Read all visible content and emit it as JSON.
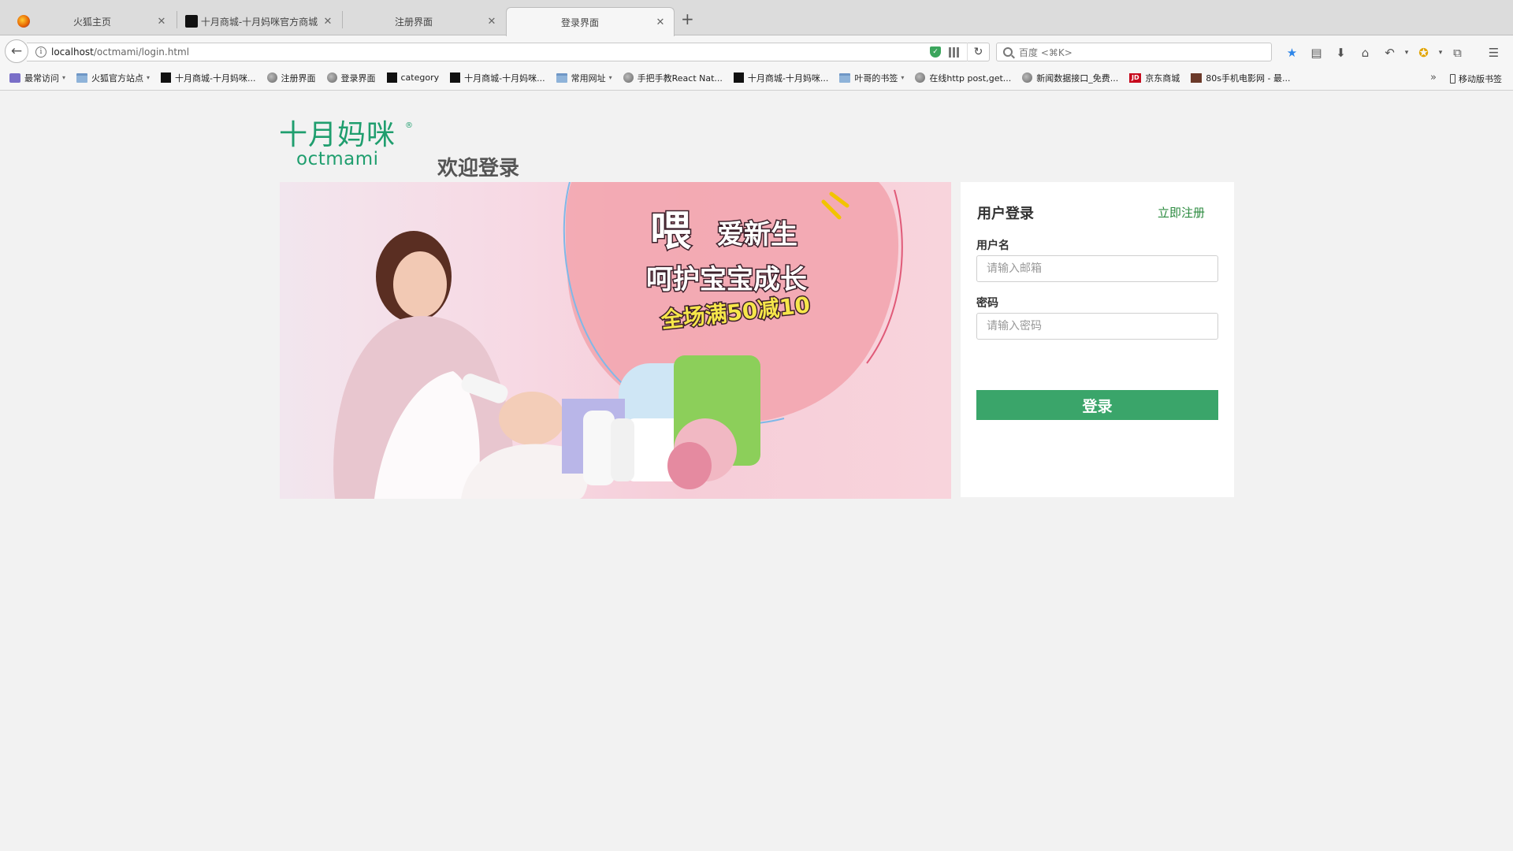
{
  "browser": {
    "tabs": [
      {
        "title": "火狐主页",
        "active": false
      },
      {
        "title": "十月商城-十月妈咪官方商城",
        "active": false
      },
      {
        "title": "注册界面",
        "active": false
      },
      {
        "title": "登录界面",
        "active": true
      }
    ],
    "url": {
      "host": "localhost",
      "path": "/octmami/login.html"
    },
    "search_placeholder": "百度 <⌘K>",
    "bookmarks": [
      {
        "label": "最常访问",
        "icon": "most-visited-icon",
        "dropdown": true
      },
      {
        "label": "火狐官方站点",
        "icon": "folder-icon",
        "dropdown": true
      },
      {
        "label": "十月商城-十月妈咪...",
        "icon": "site-favicon-black"
      },
      {
        "label": "注册界面",
        "icon": "globe-icon"
      },
      {
        "label": "登录界面",
        "icon": "globe-icon"
      },
      {
        "label": "category",
        "icon": "site-favicon-black"
      },
      {
        "label": "十月商城-十月妈咪...",
        "icon": "site-favicon-black"
      },
      {
        "label": "常用网址",
        "icon": "folder-icon",
        "dropdown": true
      },
      {
        "label": "手把手教React Nat...",
        "icon": "globe-icon"
      },
      {
        "label": "十月商城-十月妈咪...",
        "icon": "site-favicon-black"
      },
      {
        "label": "叶哥的书签",
        "icon": "folder-icon",
        "dropdown": true
      },
      {
        "label": "在线http post,get...",
        "icon": "globe-icon"
      },
      {
        "label": "新闻数据接口_免费...",
        "icon": "globe-icon"
      },
      {
        "label": "京东商城",
        "icon": "jd-icon"
      },
      {
        "label": "80s手机电影网 - 最...",
        "icon": "film-icon"
      }
    ],
    "mobile_bookmarks": "移动版书签",
    "more_bookmarks": "»"
  },
  "page": {
    "logo": {
      "cn": "十月妈咪",
      "en": "octmami",
      "reg": "®"
    },
    "welcome": "欢迎登录",
    "banner": {
      "headline_quote_word": "喂",
      "headline_rest": "爱新生",
      "subline": "呵护宝宝成长",
      "promo": "全场满50减10"
    },
    "login": {
      "title": "用户登录",
      "register_link": "立即注册",
      "username_label": "用户名",
      "username_placeholder": "请输入邮箱",
      "username_value": "",
      "password_label": "密码",
      "password_placeholder": "请输入密码",
      "password_value": "",
      "submit_label": "登录"
    }
  },
  "colors": {
    "brand_green": "#1f9e6e",
    "button_green": "#3aa56a",
    "link_green": "#2a8a3e",
    "page_bg": "#f2f2f2"
  }
}
